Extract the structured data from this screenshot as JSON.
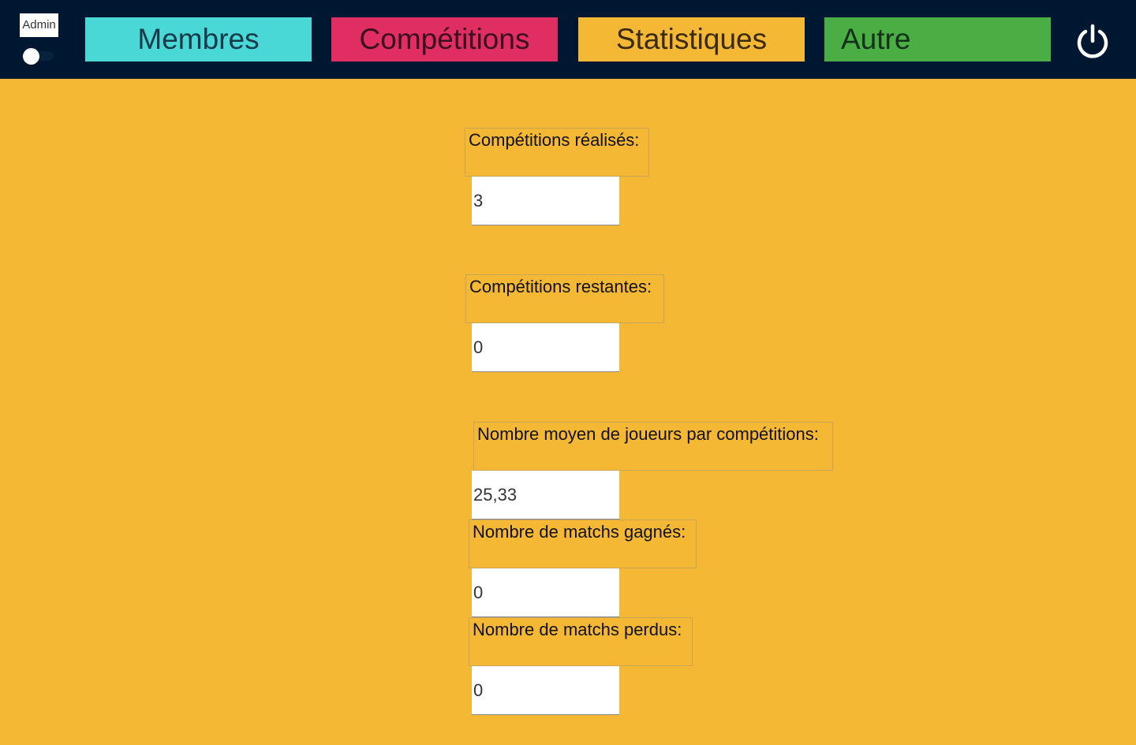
{
  "header": {
    "admin_label": "Admin",
    "nav": {
      "membres": "Membres",
      "competitions": "Compétitions",
      "statistiques": "Statistiques",
      "autre": "Autre"
    },
    "power_icon": "power-icon"
  },
  "stats": {
    "competitions_realisees": {
      "label": "Compétitions réalisés:",
      "value": "3"
    },
    "competitions_restantes": {
      "label": "Compétitions restantes:",
      "value": "0"
    },
    "moyenne_joueurs": {
      "label": "Nombre moyen de joueurs par compétitions:",
      "value": "25,33"
    },
    "matchs_gagnes": {
      "label": "Nombre de matchs gagnés:",
      "value": "0"
    },
    "matchs_perdus": {
      "label": "Nombre de matchs perdus:",
      "value": "0"
    }
  },
  "colors": {
    "header_bg": "#001731",
    "page_bg": "#F4B835",
    "membres": "#4AD8D6",
    "competitions": "#E02E62",
    "statistiques": "#F4B835",
    "autre": "#4AAE44"
  }
}
